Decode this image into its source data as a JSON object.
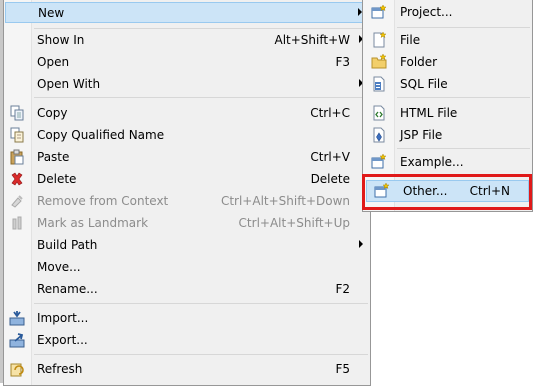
{
  "main_menu": {
    "items": [
      {
        "label": "New",
        "shortcut": "",
        "submenu": true,
        "highlight": true
      },
      {
        "label": "Show In",
        "shortcut": "Alt+Shift+W",
        "submenu": true
      },
      {
        "label": "Open",
        "shortcut": "F3"
      },
      {
        "label": "Open With",
        "shortcut": "",
        "submenu": true
      },
      {
        "label": "Copy",
        "shortcut": "Ctrl+C",
        "icon": "copy-icon"
      },
      {
        "label": "Copy Qualified Name",
        "shortcut": "",
        "icon": "copy-qualified-name-icon"
      },
      {
        "label": "Paste",
        "shortcut": "Ctrl+V",
        "icon": "paste-icon"
      },
      {
        "label": "Delete",
        "shortcut": "Delete",
        "icon": "delete-icon"
      },
      {
        "label": "Remove from Context",
        "shortcut": "Ctrl+Alt+Shift+Down",
        "disabled": true,
        "icon": "remove-from-context-icon"
      },
      {
        "label": "Mark as Landmark",
        "shortcut": "Ctrl+Alt+Shift+Up",
        "disabled": true,
        "icon": "landmark-icon"
      },
      {
        "label": "Build Path",
        "shortcut": "",
        "submenu": true
      },
      {
        "label": "Move...",
        "shortcut": ""
      },
      {
        "label": "Rename...",
        "shortcut": "F2"
      },
      {
        "label": "Import...",
        "shortcut": "",
        "icon": "import-icon"
      },
      {
        "label": "Export...",
        "shortcut": "",
        "icon": "export-icon"
      },
      {
        "label": "Refresh",
        "shortcut": "F5",
        "icon": "refresh-icon"
      }
    ]
  },
  "new_submenu": {
    "items": [
      {
        "label": "Project...",
        "shortcut": "",
        "icon": "new-project-icon"
      },
      {
        "label": "File",
        "shortcut": "",
        "icon": "new-file-icon"
      },
      {
        "label": "Folder",
        "shortcut": "",
        "icon": "new-folder-icon"
      },
      {
        "label": "SQL File",
        "shortcut": "",
        "icon": "sql-file-icon"
      },
      {
        "label": "HTML File",
        "shortcut": "",
        "icon": "html-file-icon"
      },
      {
        "label": "JSP File",
        "shortcut": "",
        "icon": "jsp-file-icon"
      },
      {
        "label": "Example...",
        "shortcut": "",
        "icon": "example-icon"
      },
      {
        "label": "Other...",
        "shortcut": "Ctrl+N",
        "icon": "other-wizard-icon",
        "highlight": true
      }
    ]
  },
  "colors": {
    "highlight_bg": "#cce4f7",
    "highlight_border": "#99c9ef",
    "callout_red": "#e01919"
  }
}
